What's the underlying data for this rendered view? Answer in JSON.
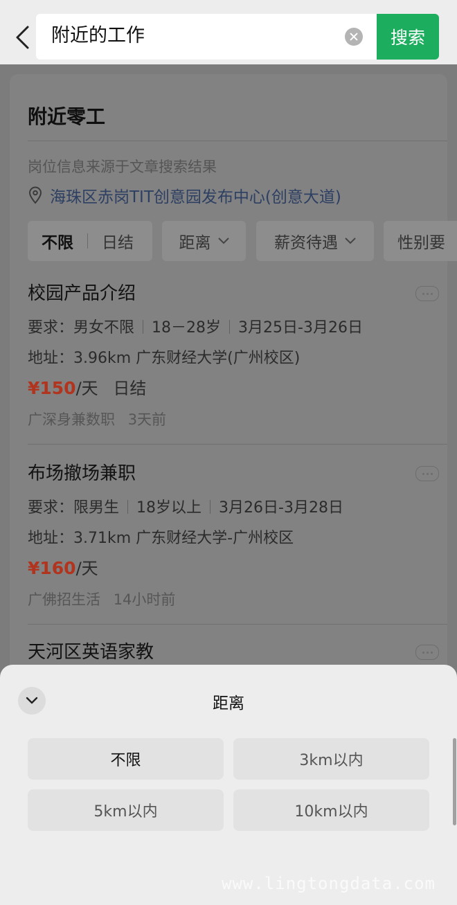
{
  "header": {
    "search_value": "附近的工作",
    "search_button": "搜索"
  },
  "card": {
    "title": "附近零工",
    "source_note": "岗位信息来源于文章搜索结果",
    "location": "海珠区赤岗TIT创意园发布中心(创意大道)",
    "filters": {
      "segment": [
        "不限",
        "日结"
      ],
      "distance": "距离",
      "salary": "薪资待遇",
      "gender": "性别要"
    }
  },
  "jobs": [
    {
      "title": "校园产品介绍",
      "req_label": "要求：",
      "req": [
        "男女不限",
        "18－28岁",
        "3月25日-3月26日"
      ],
      "addr": "地址：3.96km 广东财经大学(广州校区)",
      "salary_amount": "¥150",
      "salary_unit": "/天",
      "salary_type": "日结",
      "source": "广深身兼数职",
      "time": "3天前"
    },
    {
      "title": "布场撤场兼职",
      "req_label": "要求：",
      "req": [
        "限男生",
        "18岁以上",
        "3月26日-3月28日"
      ],
      "addr": "地址：3.71km 广东财经大学-广州校区",
      "salary_amount": "¥160",
      "salary_unit": "/天",
      "salary_type": "",
      "source": "广佛招生活",
      "time": "14小时前"
    },
    {
      "title": "天河区英语家教"
    }
  ],
  "sheet": {
    "title": "距离",
    "options": [
      "不限",
      "3km以内",
      "5km以内",
      "10km以内"
    ],
    "selected": "不限"
  },
  "watermark": "www.lingtongdata.com",
  "colors": {
    "accent_green": "#1dad5f",
    "salary_red": "#e5462a"
  }
}
